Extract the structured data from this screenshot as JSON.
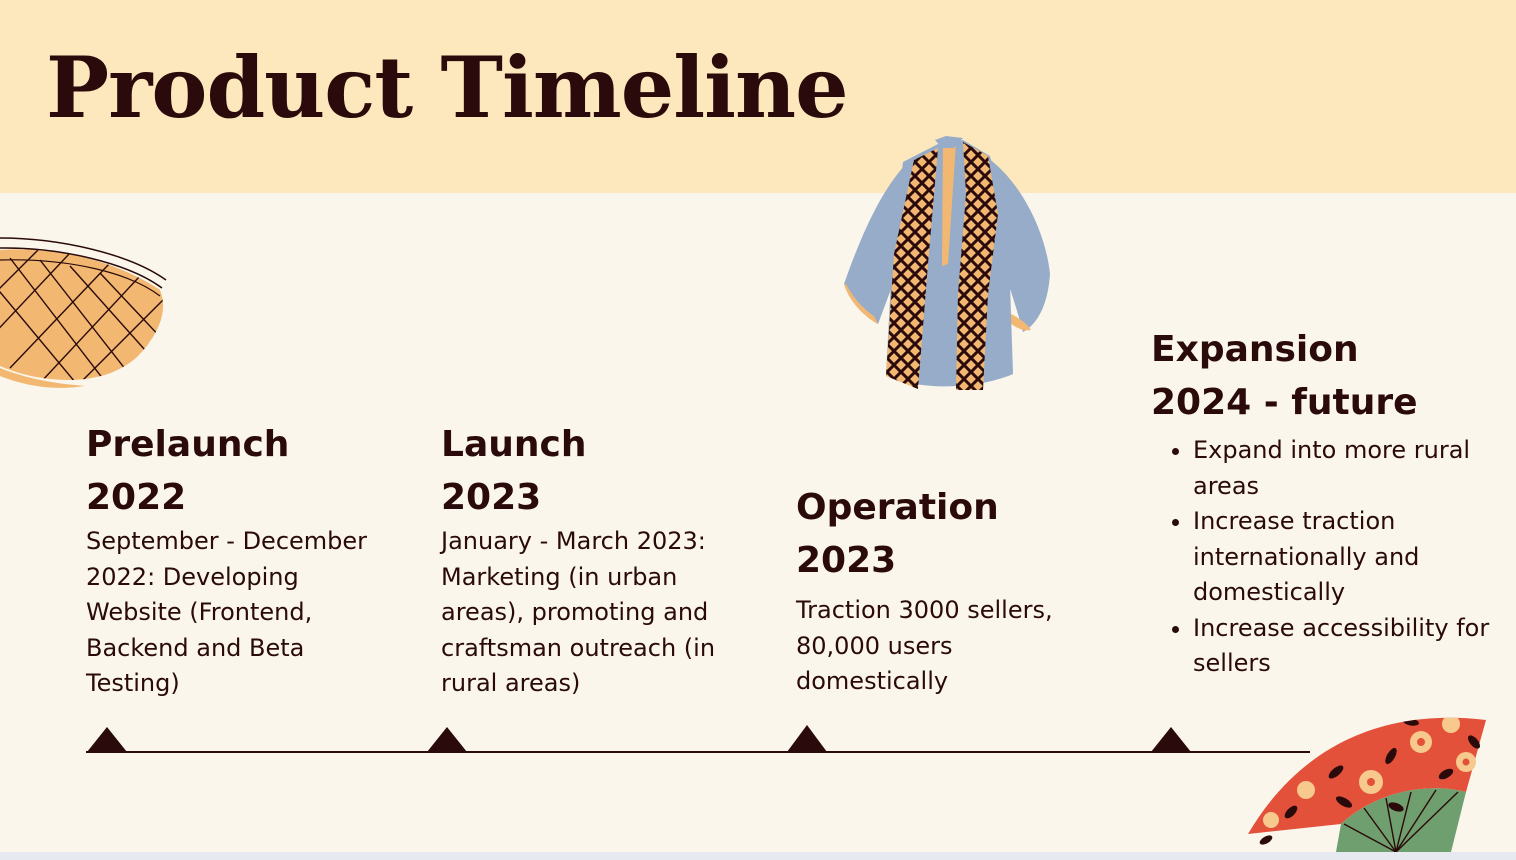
{
  "title": "Product Timeline",
  "phases": [
    {
      "name": "Prelaunch",
      "period": "2022",
      "description": "September - December 2022: Developing Website (Frontend, Backend and Beta Testing)"
    },
    {
      "name": "Launch",
      "period": "2023",
      "description": "January - March 2023: Marketing (in urban areas), promoting and craftsman outreach (in rural areas)"
    },
    {
      "name": "Operation",
      "period": "2023",
      "description": "Traction 3000 sellers, 80,000 users domestically"
    },
    {
      "name": "Expansion",
      "period": "2024 - future",
      "bullets": [
        "Expand into more rural areas",
        "Increase traction internationally and domestically",
        "Increase accessibility for sellers"
      ]
    }
  ],
  "colors": {
    "header_band": "#fde8bd",
    "background": "#faf6ec",
    "text": "#2a0a0a",
    "jacket_blue": "#97acc8",
    "basket_orange": "#f2b871",
    "fan_red": "#e3513a",
    "fan_green": "#6f9f6f"
  },
  "icons": [
    "woven-basket-icon",
    "embroidered-jacket-icon",
    "folding-fan-icon"
  ]
}
